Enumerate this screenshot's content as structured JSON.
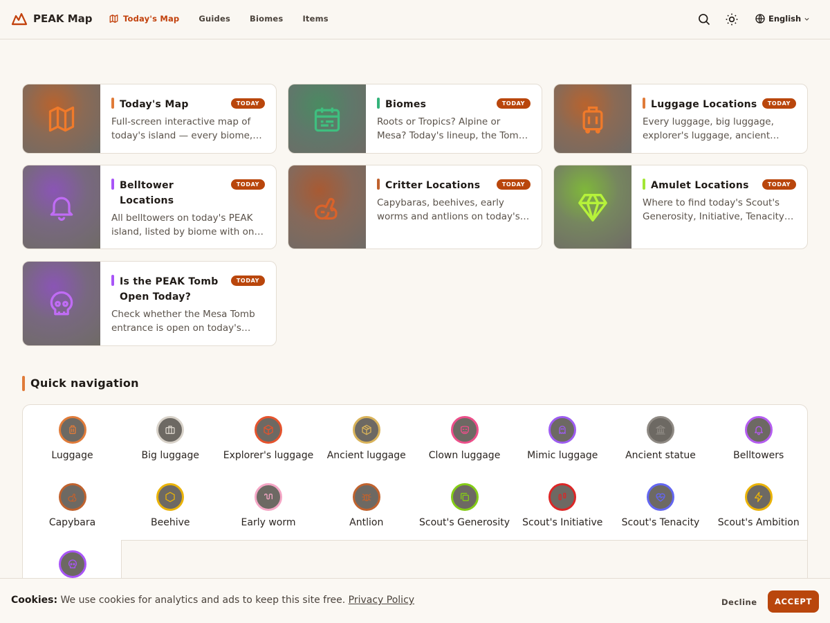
{
  "brand": {
    "name": "PEAK Map",
    "icon": "mountain-icon",
    "color": "#c2410c"
  },
  "nav": [
    {
      "label": "Today's Map",
      "icon": "map-icon",
      "active": true
    },
    {
      "label": "Guides"
    },
    {
      "label": "Biomes"
    },
    {
      "label": "Items"
    }
  ],
  "header_actions": {
    "search_icon": "search-icon",
    "theme_icon": "sun-icon",
    "language": "English",
    "language_icon": "globe-icon"
  },
  "cards": [
    {
      "title": "Today's Map",
      "badge": "TODAY",
      "desc": "Full-screen interactive map of today's island — every biome, luggage, and collectible marked.",
      "icon": "map-icon",
      "accent": "#e07b39"
    },
    {
      "title": "Biomes",
      "badge": "TODAY",
      "desc": "Roots or Tropics? Alpine or Mesa? Today's lineup, the Tomb status and more.",
      "icon": "calendar-icon",
      "accent": "#34b37a"
    },
    {
      "title": "Luggage Locations",
      "badge": "TODAY",
      "desc": "Every luggage, big luggage, explorer's luggage, ancient luggage and more.",
      "icon": "luggage-icon",
      "accent": "#e07b39"
    },
    {
      "title": "Belltower Locations",
      "badge": "TODAY",
      "desc": "All belltowers on today's PEAK island, listed by biome with one-click map links.",
      "icon": "bell-icon",
      "accent": "#a855f7"
    },
    {
      "title": "Critter Locations",
      "badge": "TODAY",
      "desc": "Capybaras, beehives, early worms and antlions on today's island.",
      "icon": "rabbit-icon",
      "accent": "#c0622e"
    },
    {
      "title": "Amulet Locations",
      "badge": "TODAY",
      "desc": "Where to find today's Scout's Generosity, Initiative, Tenacity and Ambition.",
      "icon": "gem-icon",
      "accent": "#a3e635"
    },
    {
      "title": "Is the PEAK Tomb Open Today?",
      "badge": "TODAY",
      "desc": "Check whether the Mesa Tomb entrance is open on today's PEAK island.",
      "icon": "skull-icon",
      "accent": "#a855f7"
    }
  ],
  "quick_nav": {
    "title": "Quick navigation",
    "items": [
      {
        "label": "Luggage",
        "icon": "luggage-icon",
        "color": "#e07b39"
      },
      {
        "label": "Big luggage",
        "icon": "briefcase-icon",
        "color": "#d8d2c9"
      },
      {
        "label": "Explorer's luggage",
        "icon": "box-icon",
        "color": "#e5532d"
      },
      {
        "label": "Ancient luggage",
        "icon": "package-icon",
        "color": "#d9b35a"
      },
      {
        "label": "Clown luggage",
        "icon": "mask-icon",
        "color": "#ec4f8a"
      },
      {
        "label": "Mimic luggage",
        "icon": "ghost-icon",
        "color": "#9d5cf0"
      },
      {
        "label": "Ancient statue",
        "icon": "landmark-icon",
        "color": "#8f8a84"
      },
      {
        "label": "Belltowers",
        "icon": "bell-icon",
        "color": "#b45cf0"
      },
      {
        "label": "Capybara",
        "icon": "rabbit-icon",
        "color": "#c0622e"
      },
      {
        "label": "Beehive",
        "icon": "hexagon-icon",
        "color": "#eab308"
      },
      {
        "label": "Early worm",
        "icon": "worm-icon",
        "color": "#f4a6c5"
      },
      {
        "label": "Antlion",
        "icon": "bug-icon",
        "color": "#c0622e"
      },
      {
        "label": "Scout's Generosity",
        "icon": "copy-icon",
        "color": "#84cc16"
      },
      {
        "label": "Scout's Initiative",
        "icon": "footprints-icon",
        "color": "#dc2626"
      },
      {
        "label": "Scout's Tenacity",
        "icon": "heart-pulse-icon",
        "color": "#6366f1"
      },
      {
        "label": "Scout's Ambition",
        "icon": "zap-icon",
        "color": "#eab308"
      },
      {
        "label": "",
        "icon": "skull-icon",
        "color": "#a855f7"
      }
    ]
  },
  "cookie": {
    "label": "Cookies:",
    "text": "We use cookies for analytics and ads to keep this site free.",
    "link": "Privacy Policy",
    "decline": "Decline",
    "accept": "ACCEPT"
  }
}
